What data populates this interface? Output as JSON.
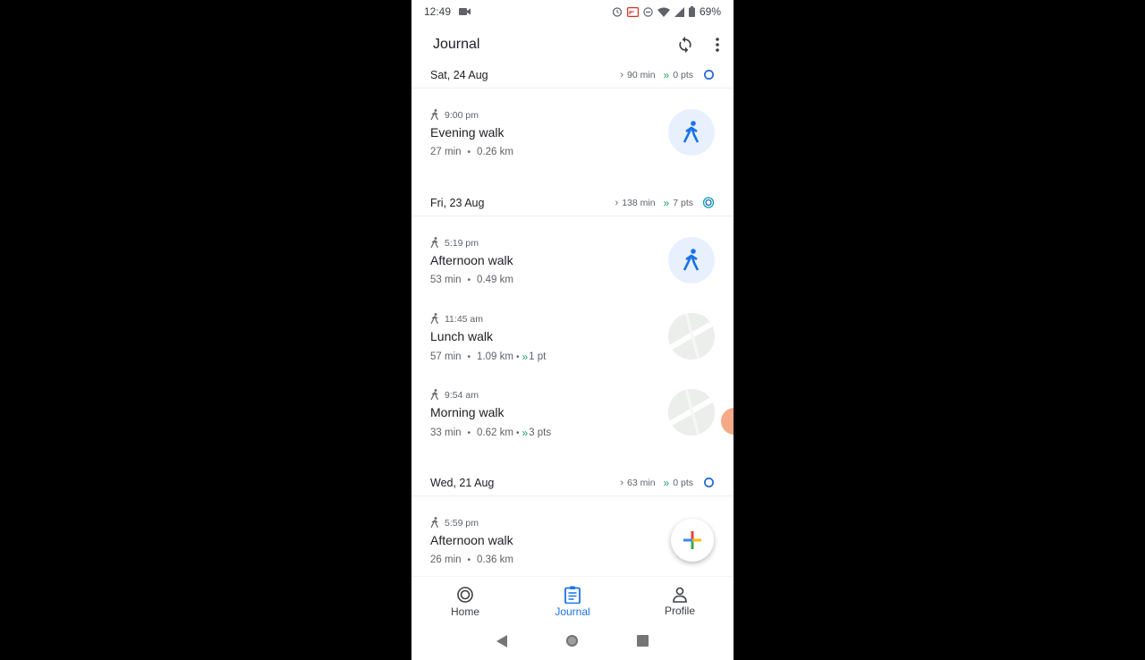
{
  "status_bar": {
    "time": "12:49",
    "battery": "69%"
  },
  "app_bar": {
    "title": "Journal"
  },
  "days": [
    {
      "date": "Sat, 24 Aug",
      "minutes": "90 min",
      "points": "0 pts"
    },
    {
      "date": "Fri, 23 Aug",
      "minutes": "138 min",
      "points": "7 pts"
    },
    {
      "date": "Wed, 21 Aug",
      "minutes": "63 min",
      "points": "0 pts"
    }
  ],
  "activities": [
    {
      "time": "9:00 pm",
      "name": "Evening walk",
      "duration": "27 min",
      "distance": "0.26 km",
      "points": ""
    },
    {
      "time": "5:19 pm",
      "name": "Afternoon walk",
      "duration": "53 min",
      "distance": "0.49 km",
      "points": ""
    },
    {
      "time": "11:45 am",
      "name": "Lunch walk",
      "duration": "57 min",
      "distance": "1.09 km",
      "points": "1 pt"
    },
    {
      "time": "9:54 am",
      "name": "Morning walk",
      "duration": "33 min",
      "distance": "0.62 km",
      "points": "3 pts"
    },
    {
      "time": "5:59 pm",
      "name": "Afternoon walk",
      "duration": "26 min",
      "distance": "0.36 km",
      "points": ""
    }
  ],
  "bottom_nav": {
    "home": "Home",
    "journal": "Journal",
    "profile": "Profile"
  },
  "colors": {
    "accent": "#1a73e8",
    "points_green": "#1ea362",
    "ring_teal": "#12a4a4"
  }
}
